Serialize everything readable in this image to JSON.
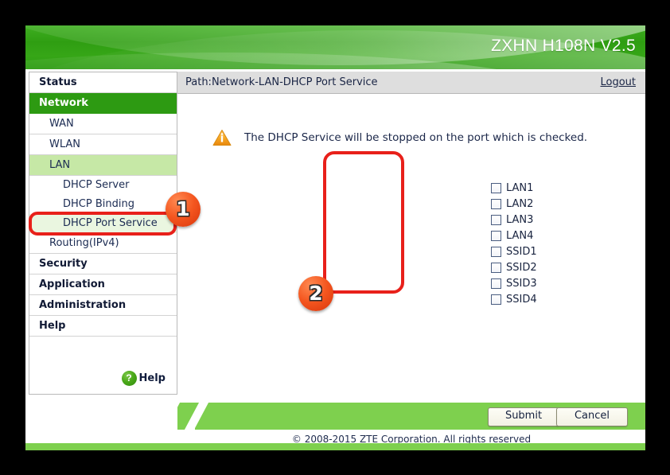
{
  "header": {
    "model_title": "ZXHN H108N V2.5"
  },
  "sidebar": {
    "items": [
      {
        "label": "Status",
        "level": "top",
        "state": "normal"
      },
      {
        "label": "Network",
        "level": "top",
        "state": "active"
      },
      {
        "label": "WAN",
        "level": "sub",
        "state": "normal"
      },
      {
        "label": "WLAN",
        "level": "sub",
        "state": "normal"
      },
      {
        "label": "LAN",
        "level": "sub",
        "state": "active"
      },
      {
        "label": "DHCP Server",
        "level": "sub2",
        "state": "normal"
      },
      {
        "label": "DHCP Binding",
        "level": "sub2",
        "state": "normal"
      },
      {
        "label": "DHCP Port Service",
        "level": "sub2",
        "state": "selected"
      },
      {
        "label": "Routing(IPv4)",
        "level": "sub",
        "state": "normal"
      },
      {
        "label": "Security",
        "level": "top",
        "state": "normal"
      },
      {
        "label": "Application",
        "level": "top",
        "state": "normal"
      },
      {
        "label": "Administration",
        "level": "top",
        "state": "normal"
      },
      {
        "label": "Help",
        "level": "top",
        "state": "normal"
      }
    ],
    "help_launcher": {
      "icon": "question-mark-circle-icon",
      "glyph": "?",
      "label": "Help"
    }
  },
  "pathbar": {
    "path": "Path:Network-LAN-DHCP Port Service",
    "logout": "Logout"
  },
  "panel": {
    "warning": {
      "icon": "warning-triangle-icon",
      "message": "The DHCP Service will be stopped on the port which is checked."
    },
    "ports": [
      {
        "label": "LAN1",
        "checked": false
      },
      {
        "label": "LAN2",
        "checked": false
      },
      {
        "label": "LAN3",
        "checked": false
      },
      {
        "label": "LAN4",
        "checked": false
      },
      {
        "label": "SSID1",
        "checked": false
      },
      {
        "label": "SSID2",
        "checked": false
      },
      {
        "label": "SSID3",
        "checked": false
      },
      {
        "label": "SSID4",
        "checked": false
      }
    ]
  },
  "footer": {
    "submit_label": "Submit",
    "cancel_label": "Cancel",
    "copyright": "© 2008-2015 ZTE Corporation. All rights reserved"
  },
  "annotations": {
    "badge_1": "1",
    "badge_2": "2"
  },
  "colors": {
    "brand_green": "#2d9a12",
    "light_green": "#7ed04e",
    "menu_highlight": "#c6e8a6",
    "annotation_red": "#e8201a",
    "badge_orange": "#f4561f",
    "warning_orange": "#f5a623"
  }
}
